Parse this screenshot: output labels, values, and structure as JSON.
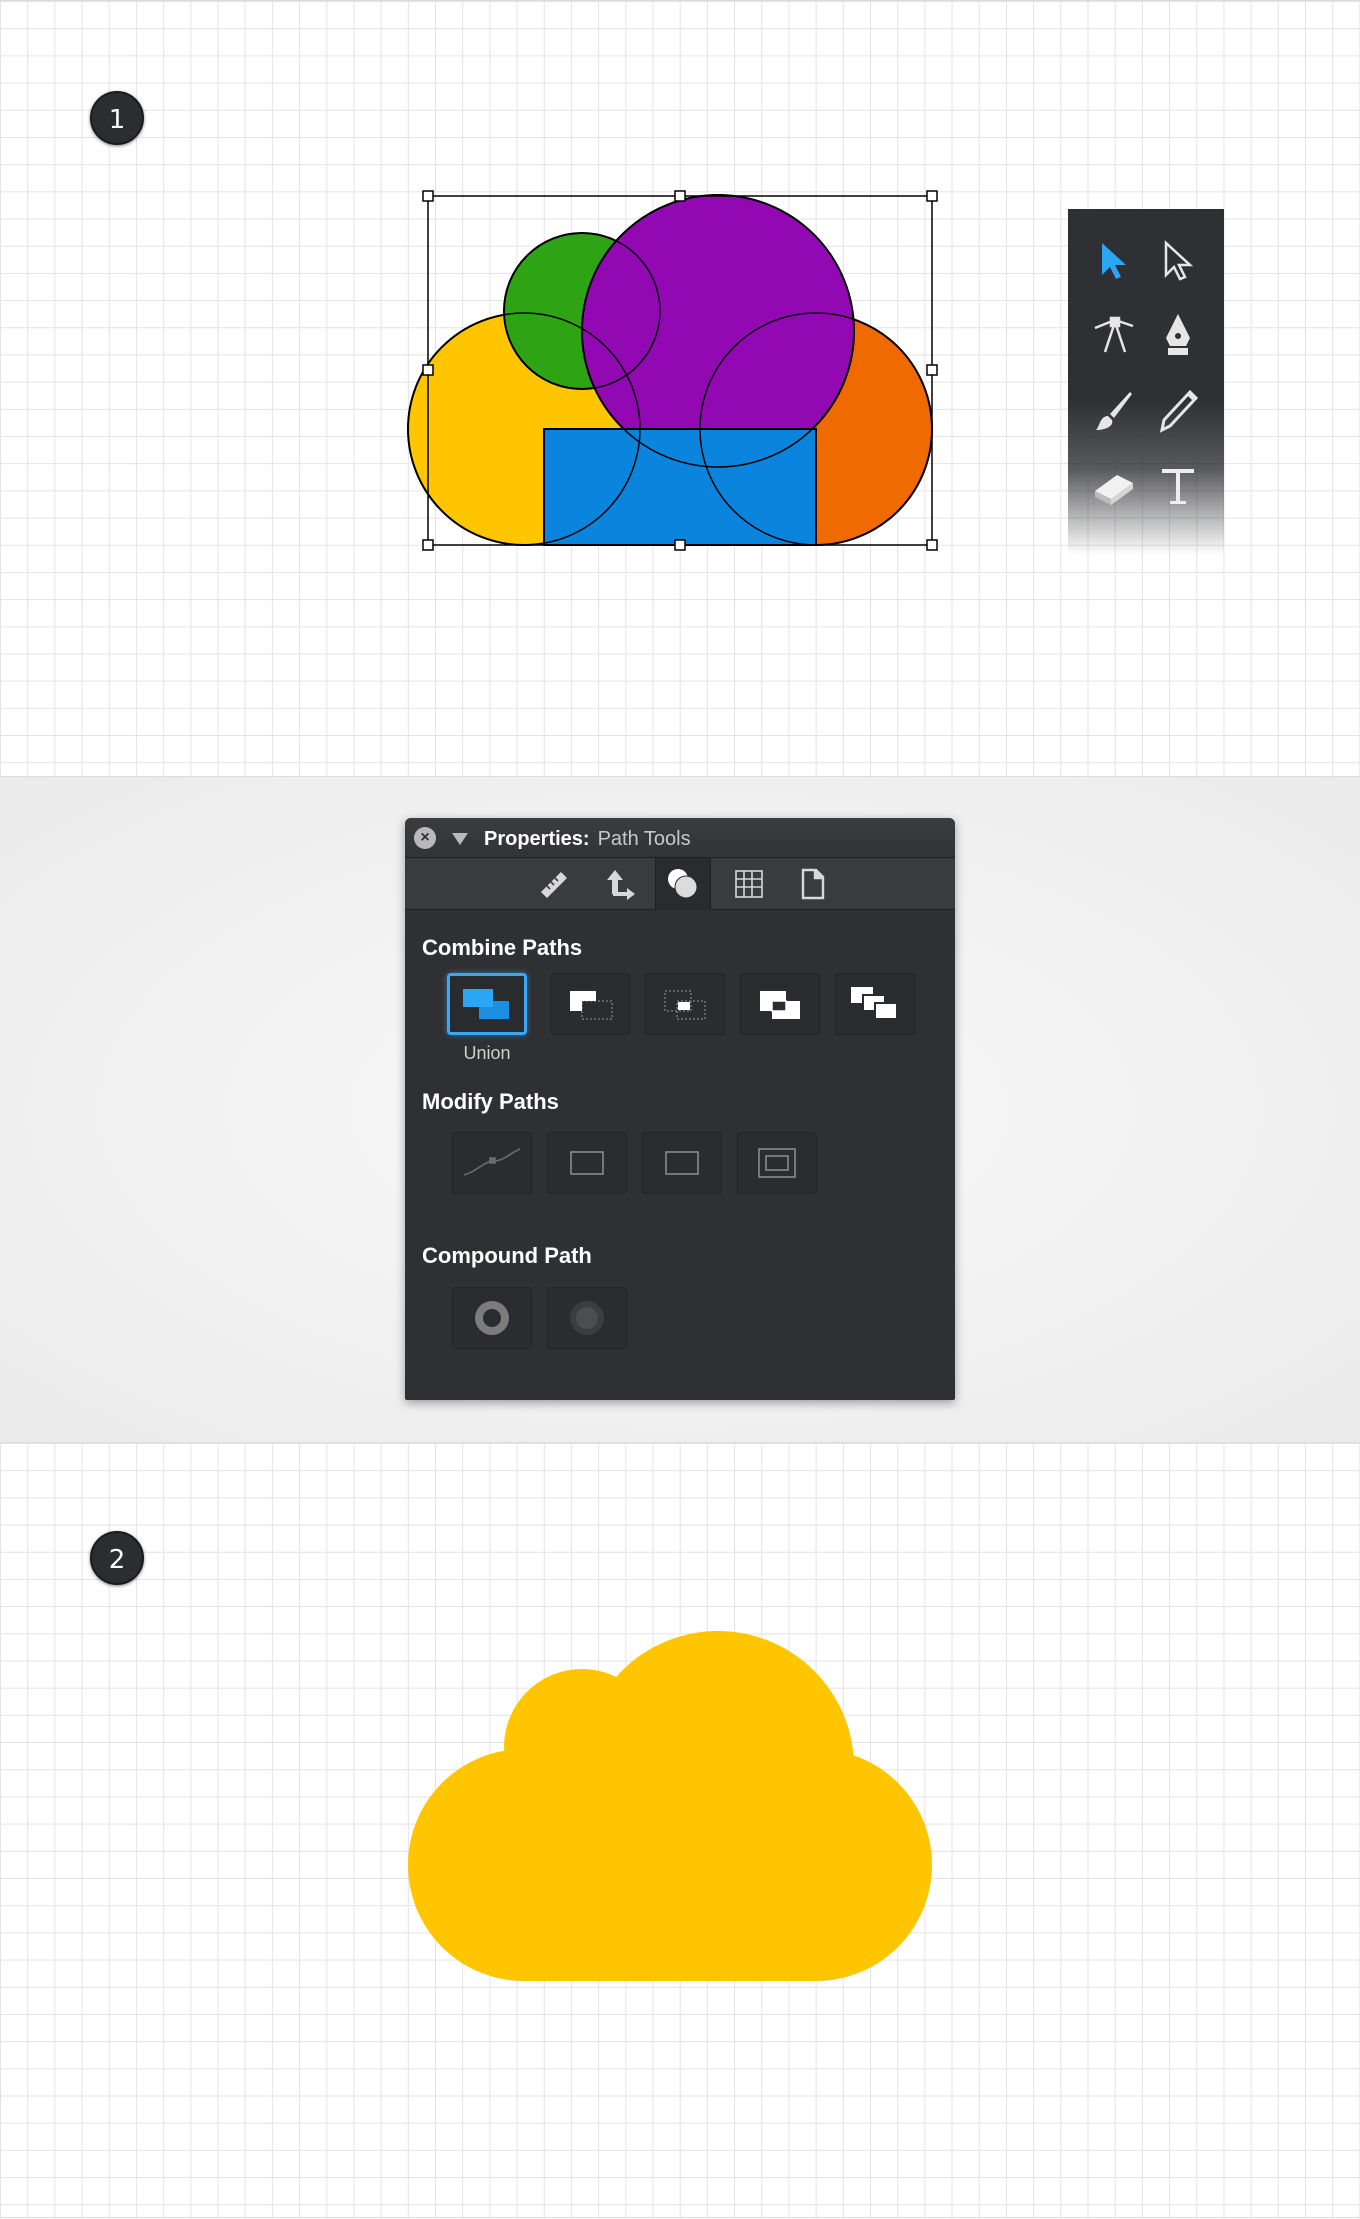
{
  "step1": {
    "badge": "1"
  },
  "step2": {
    "badge": "2"
  },
  "shape_colors": {
    "yellow": "#ffc600",
    "green": "#2ea313",
    "purple": "#9209b3",
    "orange": "#ef6a00",
    "blue": "#0a84dc",
    "union_result": "#ffc600"
  },
  "toolbox": {
    "tools": [
      "selection-arrow-icon",
      "direct-selection-arrow-icon",
      "node-tool-icon",
      "pen-nib-icon",
      "brush-icon",
      "pencil-icon",
      "eraser-icon",
      "text-tool-icon"
    ],
    "active_color": "#2aa6f4"
  },
  "properties_panel": {
    "title_label": "Properties:",
    "title_value": "Path Tools",
    "tabs": [
      "ruler-icon",
      "transform-arrows-icon",
      "path-ops-icon",
      "grid-icon",
      "document-icon"
    ],
    "combine_paths": {
      "label": "Combine Paths",
      "buttons": [
        "union-icon",
        "subtract-icon",
        "intersect-icon",
        "exclude-icon",
        "divide-icon"
      ],
      "selected_caption": "Union"
    },
    "modify_paths": {
      "label": "Modify Paths",
      "buttons": [
        "curve-icon",
        "dashed-rect-icon",
        "rect-icon",
        "inset-rect-icon"
      ]
    },
    "compound_path": {
      "label": "Compound Path",
      "buttons": [
        "make-compound-icon",
        "release-compound-icon"
      ]
    },
    "accent_color": "#3aa8f5"
  }
}
